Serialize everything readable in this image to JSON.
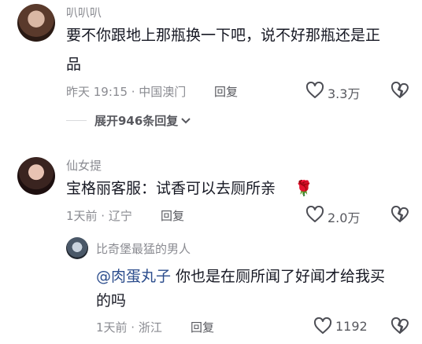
{
  "comments": [
    {
      "username": "叭叭叭",
      "text": "要不你跟地上那瓶换一下吧，说不好那瓶还是正品",
      "line1": "要不你跟地上那瓶换一下吧，说不好那瓶还是正",
      "line2": "品",
      "time": "昨天 19:15 · 中国澳门",
      "reply_label": "回复",
      "likes": "3.3万",
      "expand_label": "展开946条回复"
    },
    {
      "username": "仙女提",
      "text": "宝格丽客服：试香可以去厕所亲",
      "emoji": "🌹",
      "time": "1天前 · 辽宁",
      "reply_label": "回复",
      "likes": "2.0万"
    }
  ],
  "reply": {
    "username": "比奇堡最猛的男人",
    "mention": "@肉蛋丸子",
    "line1": " 你也是在厕所闻了好闻才给我买",
    "line2": "的吗",
    "time": "1天前 · 浙江",
    "reply_label": "回复",
    "likes": "1192"
  },
  "icons": {
    "like": "heart-outline-icon",
    "dislike": "broken-heart-icon",
    "expand": "chevron-down-icon"
  }
}
